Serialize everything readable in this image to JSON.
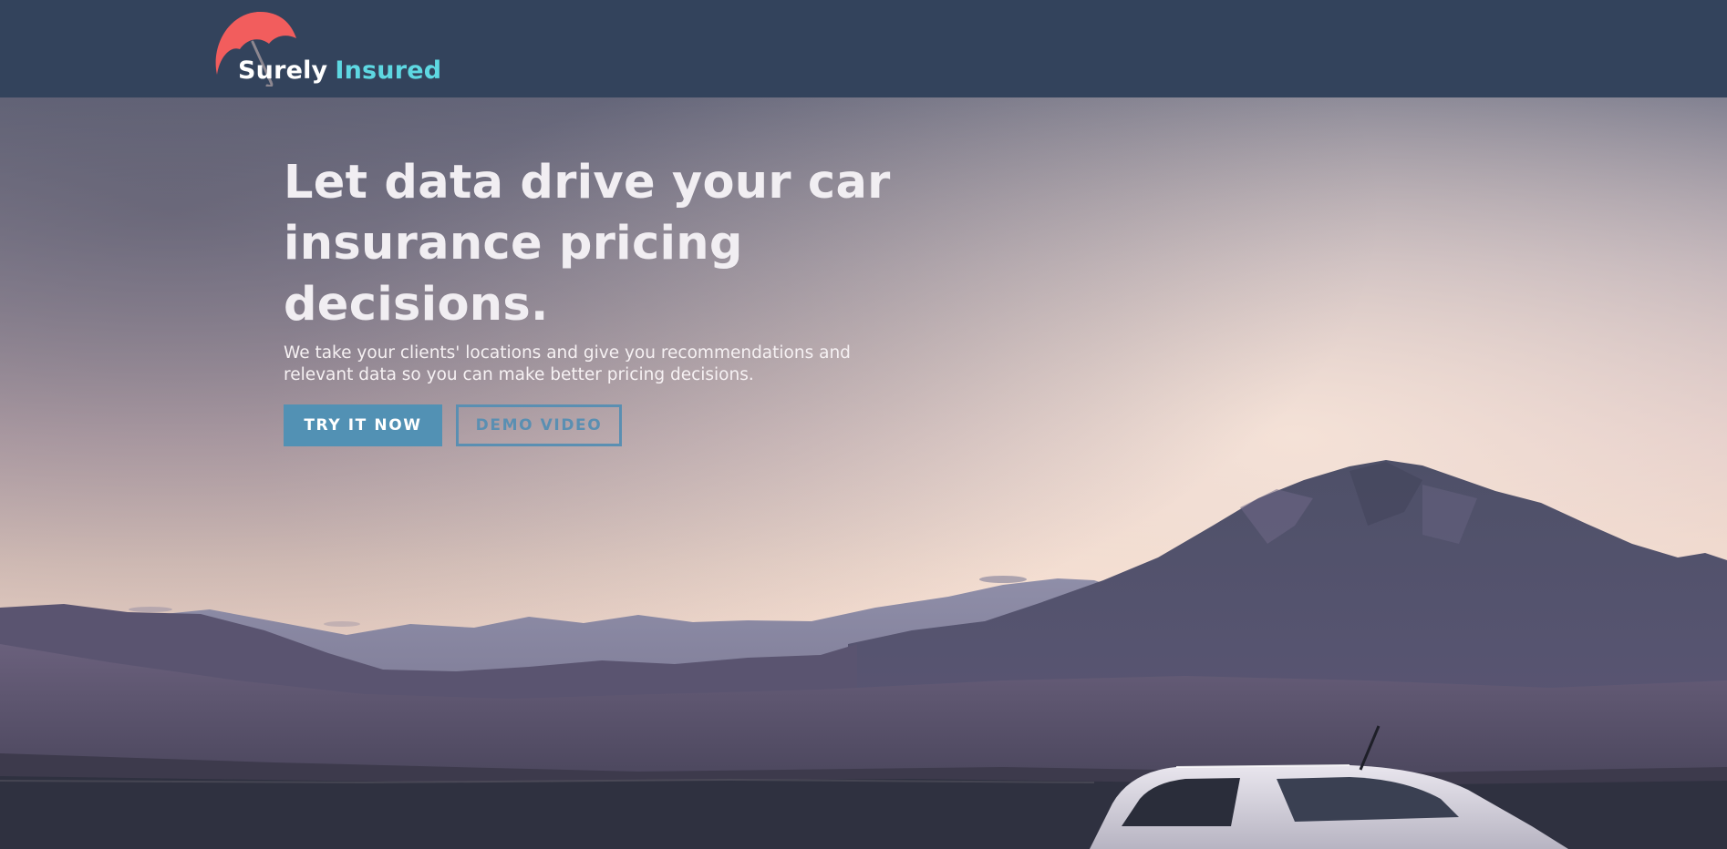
{
  "brand": {
    "name_part1": "Surely",
    "name_part2": "Insured",
    "logo_icon": "umbrella-icon",
    "colors": {
      "umbrella": "#f25d5d",
      "name_part1": "#ffffff",
      "name_part2": "#5ed8e2"
    }
  },
  "navbar": {
    "background": "#33435c"
  },
  "hero": {
    "title_lines": [
      "Let data drive your car",
      "insurance pricing",
      "decisions."
    ],
    "subtitle_lines": [
      "We take your clients' locations and give you recommendations and",
      "relevant data so you can make better pricing decisions."
    ],
    "primary_button": "TRY IT NOW",
    "secondary_button": "DEMO VIDEO",
    "background_image": "dusk sky over mountain range with white car",
    "colors": {
      "primary_button": "#5291b4",
      "secondary_button_border": "#5a8fb2"
    }
  }
}
